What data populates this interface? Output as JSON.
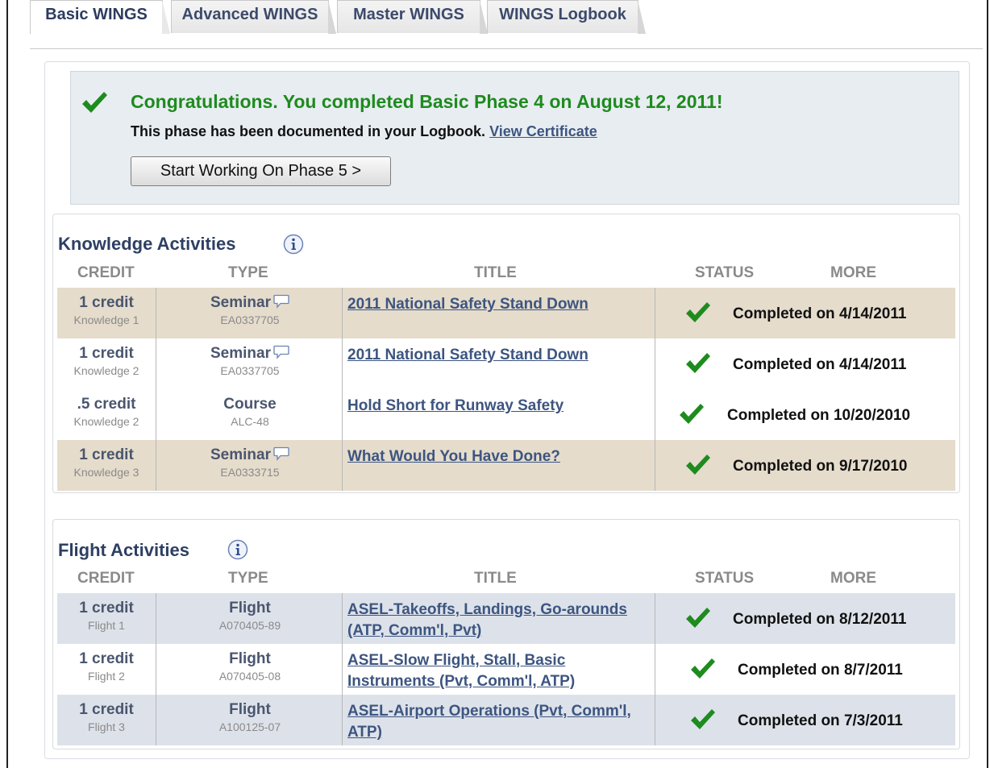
{
  "tabs": [
    {
      "label": "Basic WINGS",
      "active": true
    },
    {
      "label": "Advanced WINGS",
      "active": false
    },
    {
      "label": "Master WINGS",
      "active": false
    },
    {
      "label": "WINGS Logbook",
      "active": false
    }
  ],
  "congrats": {
    "title": "Congratulations. You completed Basic Phase 4 on August 12, 2011!",
    "subtitle": "This phase has been documented in your Logbook.",
    "certificate_link": "View Certificate",
    "start_button": "Start Working On Phase 5 >"
  },
  "headers": {
    "credit": "CREDIT",
    "type": "TYPE",
    "title": "TITLE",
    "status": "STATUS",
    "more": "MORE"
  },
  "knowledge": {
    "title": "Knowledge Activities",
    "rows": [
      {
        "credit": "1 credit",
        "credit_sub": "Knowledge 1",
        "type": "Seminar",
        "type_sub": "EA0337705",
        "title": "2011 National Safety Stand Down",
        "status": "Completed on 4/14/2011"
      },
      {
        "credit": "1 credit",
        "credit_sub": "Knowledge 2",
        "type": "Seminar",
        "type_sub": "EA0337705",
        "title": "2011 National Safety Stand Down",
        "status": "Completed on 4/14/2011"
      },
      {
        "credit": ".5 credit",
        "credit_sub": "Knowledge 2",
        "type": "Course",
        "type_sub": "ALC-48",
        "title": "Hold Short for Runway Safety",
        "status": "Completed on 10/20/2010"
      },
      {
        "credit": "1 credit",
        "credit_sub": "Knowledge 3",
        "type": "Seminar",
        "type_sub": "EA0333715",
        "title": "What Would You Have Done?",
        "status": "Completed on 9/17/2010"
      }
    ]
  },
  "flight": {
    "title": "Flight Activities",
    "rows": [
      {
        "credit": "1 credit",
        "credit_sub": "Flight 1",
        "type": "Flight",
        "type_sub": "A070405-89",
        "title": "ASEL-Takeoffs, Landings, Go-arounds (ATP, Comm'l, Pvt)",
        "status": "Completed on 8/12/2011"
      },
      {
        "credit": "1 credit",
        "credit_sub": "Flight 2",
        "type": "Flight",
        "type_sub": "A070405-08",
        "title": "ASEL-Slow Flight, Stall, Basic Instruments (Pvt, Comm'l, ATP)",
        "status": "Completed on 8/7/2011"
      },
      {
        "credit": "1 credit",
        "credit_sub": "Flight 3",
        "type": "Flight",
        "type_sub": "A100125-07",
        "title": "ASEL-Airport Operations (Pvt, Comm'l, ATP)",
        "status": "Completed on 7/3/2011"
      }
    ]
  },
  "colors": {
    "check_green": "#1e8b1e",
    "link_blue": "#3d5580",
    "knowledge_shade": "#e5dccc",
    "flight_shade": "#dde2ea"
  }
}
